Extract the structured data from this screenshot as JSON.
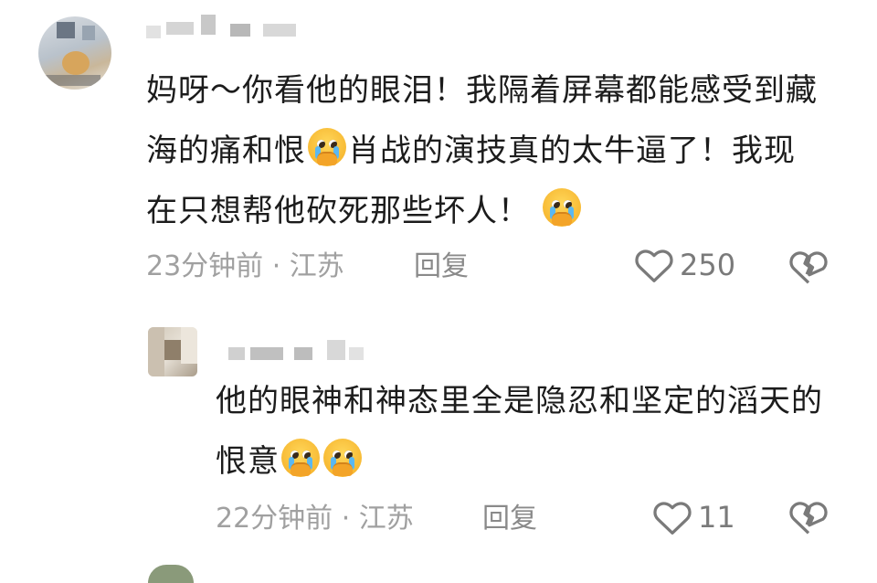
{
  "comments": [
    {
      "text": "妈呀～你看他的眼泪！我隔着屏幕都能感受到藏海的痛和恨",
      "text_after_emoji": "肖战的演技真的太牛逼了！我现在只想帮他砍死那些坏人！",
      "time": "23分钟前 · 江苏",
      "reply_label": "回复",
      "likes": "250"
    },
    {
      "text": "他的眼神和神态里全是隐忍和坚定的滔天的恨意",
      "time": "22分钟前 · 江苏",
      "reply_label": "回复",
      "likes": "11"
    }
  ],
  "icons": {
    "like": "heart-outline-icon",
    "dislike": "broken-heart-icon",
    "emoji": "crying-face-emoji"
  }
}
